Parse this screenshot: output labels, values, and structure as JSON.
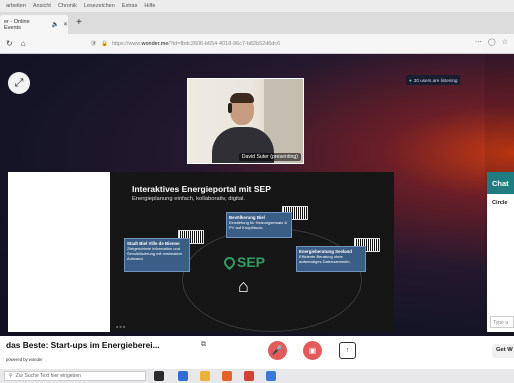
{
  "menu": {
    "items": [
      "arbeiten",
      "Ansicht",
      "Chronik",
      "Lesezeichen",
      "Extras",
      "Hilfe"
    ]
  },
  "tab": {
    "label": "er - Online Events",
    "speaker_icon": "speaker-icon",
    "close_icon": "close-icon",
    "new_tab_icon": "plus-icon"
  },
  "nav": {
    "reload_icon": "reload-icon",
    "home_icon": "home-icon",
    "url_prefix": "https://www.",
    "url_host": "wonder.me",
    "url_rest": "/?id=fbdc2606-b654-4018-96c7-b82b52d6dc6"
  },
  "stage": {
    "listening": "30 users are listening",
    "presenter_label": "David Suter (presenting)",
    "slide": {
      "title": "Interaktives Energieportal mit SEP",
      "subtitle": "Energieplanung einfach, kollaborativ, digital.",
      "logo_text": "SEP",
      "cards": [
        {
          "title": "Stadt Biel Ville de Bienne",
          "text": "Zielgerichtete Information und Sensibilisierung mit minimalem Aufwand."
        },
        {
          "title": "Bevölkerung Biel",
          "text": "Einstiefung für Heizungsersatz & PV auf Knopfdruck."
        },
        {
          "title": "Energieberatung Seeland",
          "text": "Effiziente Beratung ohne aufwendiges Datensammeln."
        }
      ]
    },
    "chat": {
      "header": "Chat",
      "tab": "Circle",
      "input_placeholder": "Type a"
    }
  },
  "footer": {
    "title": "das Beste: Start-ups im Energieberei...",
    "powered_by": "powered by wonder",
    "get_label": "Get W"
  },
  "taskbar": {
    "search_placeholder": "Zur Suche Text hier eingeben"
  },
  "colors": {
    "mic_off": "#e35a5a",
    "chat_header": "#1f7d82",
    "sep_green": "#2f9d63",
    "card_blue": "#3b5e87"
  }
}
